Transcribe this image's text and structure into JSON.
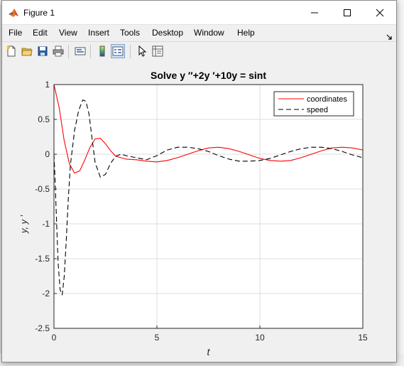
{
  "window": {
    "title": "Figure 1"
  },
  "menu": [
    "File",
    "Edit",
    "View",
    "Insert",
    "Tools",
    "Desktop",
    "Window",
    "Help"
  ],
  "toolbar_icons": [
    "new-figure-icon",
    "open-file-icon",
    "save-icon",
    "print-icon",
    "link-plot-icon",
    "colorbar-icon",
    "legend-icon",
    "edit-plot-arrow-icon",
    "property-inspector-icon"
  ],
  "colors": {
    "coordinates": "#ff0000",
    "speed": "#000000",
    "grid": "#dedede",
    "axes_bg": "#ffffff"
  },
  "chart_data": {
    "type": "line",
    "title": "Solve y ′′+2y ′+10y = sint",
    "xlabel": "t",
    "ylabel": "y, y ′",
    "xlim": [
      0,
      15
    ],
    "ylim": [
      -2.5,
      1
    ],
    "xticks": [
      0,
      5,
      10,
      15
    ],
    "yticks": [
      1,
      0.5,
      0,
      -0.5,
      -1,
      -1.5,
      -2,
      -2.5
    ],
    "grid": true,
    "legend_position": "top-right",
    "series": [
      {
        "name": "coordinates",
        "style": "solid",
        "x": [
          0,
          0.25,
          0.5,
          0.75,
          1,
          1.25,
          1.5,
          1.75,
          2,
          2.25,
          2.5,
          2.75,
          3,
          3.5,
          4,
          4.5,
          5,
          5.5,
          6,
          6.5,
          7,
          7.5,
          8,
          8.5,
          9,
          9.5,
          10,
          10.5,
          11,
          11.5,
          12,
          12.5,
          13,
          13.5,
          14,
          14.5,
          15
        ],
        "y": [
          1,
          0.67,
          0.19,
          -0.14,
          -0.27,
          -0.24,
          -0.08,
          0.1,
          0.22,
          0.23,
          0.15,
          0.05,
          -0.03,
          -0.07,
          -0.08,
          -0.1,
          -0.11,
          -0.09,
          -0.05,
          0.0,
          0.05,
          0.09,
          0.1,
          0.08,
          0.04,
          -0.01,
          -0.06,
          -0.09,
          -0.1,
          -0.09,
          -0.05,
          0.0,
          0.05,
          0.09,
          0.1,
          0.09,
          0.06
        ]
      },
      {
        "name": "speed",
        "style": "dashed",
        "x": [
          0,
          0.05,
          0.1,
          0.2,
          0.3,
          0.4,
          0.5,
          0.6,
          0.7,
          0.8,
          1,
          1.2,
          1.4,
          1.55,
          1.7,
          1.85,
          2,
          2.25,
          2.5,
          2.75,
          3,
          3.25,
          3.5,
          4,
          4.5,
          5,
          5.5,
          6,
          6.5,
          7,
          7.5,
          8,
          8.5,
          9,
          9.5,
          10,
          10.5,
          11,
          11.5,
          12,
          12.5,
          13,
          13.5,
          14,
          14.5,
          15
        ],
        "y": [
          0,
          -0.35,
          -0.75,
          -1.55,
          -1.95,
          -2.02,
          -1.75,
          -1.22,
          -0.62,
          -0.15,
          0.34,
          0.63,
          0.78,
          0.76,
          0.58,
          0.22,
          -0.12,
          -0.33,
          -0.29,
          -0.13,
          -0.03,
          0.0,
          -0.02,
          -0.05,
          -0.08,
          -0.02,
          0.06,
          0.1,
          0.1,
          0.08,
          0.04,
          -0.02,
          -0.07,
          -0.1,
          -0.1,
          -0.09,
          -0.06,
          -0.01,
          0.04,
          0.08,
          0.1,
          0.1,
          0.08,
          0.04,
          -0.01,
          -0.05
        ]
      }
    ]
  }
}
